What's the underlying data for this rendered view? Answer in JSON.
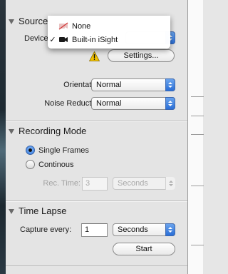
{
  "source": {
    "title": "Source",
    "device_label": "Device",
    "settings_button": "Settings...",
    "orientation_label": "Orientation:",
    "orientation_value": "Normal",
    "noise_label": "Noise Reduction:",
    "noise_value": "Normal"
  },
  "device_menu": {
    "items": [
      {
        "label": "None",
        "icon": "no-camera-icon",
        "checked": false
      },
      {
        "label": "Built-in iSight",
        "icon": "video-camera-icon",
        "checked": true
      }
    ],
    "check_glyph": "✓"
  },
  "recording": {
    "title": "Recording Mode",
    "option_single": "Single Frames",
    "option_continuous": "Continous",
    "selected": "Single Frames",
    "rec_time_label": "Rec. Time:",
    "rec_time_value": "3",
    "rec_time_unit": "Seconds"
  },
  "time_lapse": {
    "title": "Time Lapse",
    "capture_label": "Capture every:",
    "capture_value": "1",
    "capture_unit": "Seconds",
    "start_button": "Start"
  },
  "colors": {
    "accent": "#2a6ed6",
    "warning": "#f2c200",
    "panel_bg": "#e4e4e4"
  }
}
